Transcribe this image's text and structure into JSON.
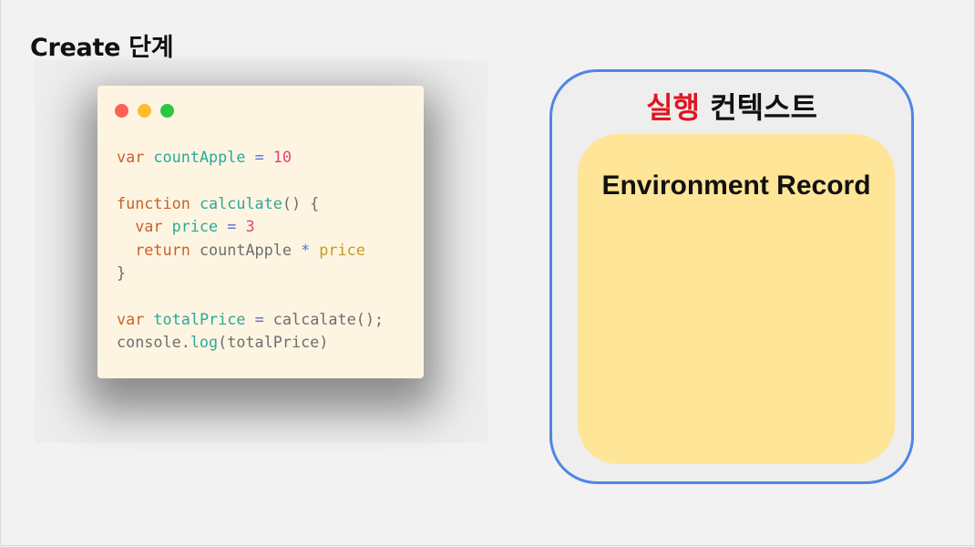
{
  "title": "Create 단계",
  "code_window": {
    "lines": [
      [
        {
          "t": "var ",
          "c": "kw"
        },
        {
          "t": "countApple",
          "c": "fn"
        },
        {
          "t": " = ",
          "c": "op"
        },
        {
          "t": "10",
          "c": "num"
        }
      ],
      [],
      [
        {
          "t": "function ",
          "c": "kw"
        },
        {
          "t": "calculate",
          "c": "fn"
        },
        {
          "t": "() {",
          "c": "pl"
        }
      ],
      [
        {
          "t": "  var ",
          "c": "kw"
        },
        {
          "t": "price",
          "c": "fn"
        },
        {
          "t": " = ",
          "c": "op"
        },
        {
          "t": "3",
          "c": "num"
        }
      ],
      [
        {
          "t": "  return ",
          "c": "kw"
        },
        {
          "t": "countApple ",
          "c": "pl"
        },
        {
          "t": "* ",
          "c": "op"
        },
        {
          "t": "price",
          "c": "pr"
        }
      ],
      [
        {
          "t": "}",
          "c": "pl"
        }
      ],
      [],
      [
        {
          "t": "var ",
          "c": "kw"
        },
        {
          "t": "totalPrice",
          "c": "fn"
        },
        {
          "t": " = ",
          "c": "op"
        },
        {
          "t": "calcalate();",
          "c": "pl"
        }
      ],
      [
        {
          "t": "console.",
          "c": "pl"
        },
        {
          "t": "log",
          "c": "fn"
        },
        {
          "t": "(totalPrice)",
          "c": "pl"
        }
      ]
    ]
  },
  "execution_context": {
    "title_highlight": "실행",
    "title_rest": " 컨텍스트",
    "environment_record": {
      "label": "Environment Record"
    }
  },
  "colors": {
    "context_border": "#4f86e6",
    "environment_fill": "#fee598",
    "highlight": "#e0161f"
  }
}
